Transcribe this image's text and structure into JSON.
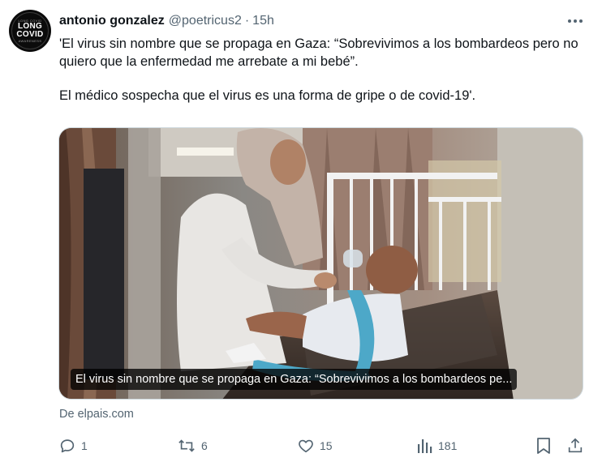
{
  "author": {
    "display_name": "antonio gonzalez",
    "handle": "@poetricus2",
    "separator": "·",
    "time": "15h",
    "avatar": {
      "line1": "LONG",
      "line2": "COVID",
      "top_text": "LONG COVID",
      "bottom_text": "AWARENESS"
    }
  },
  "post": {
    "paragraph1": "'El virus sin nombre que se propaga en Gaza: “Sobrevivimos a los bombardeos pero no quiero que la enfermedad me arrebate a mi bebé”.",
    "paragraph2": "El médico sospecha que el virus es una forma de gripe o de covid-19'."
  },
  "card": {
    "caption": "El virus sin nombre que se propaga en Gaza: “Sobrevivimos a los bombardeos pe...",
    "source": "De elpais.com"
  },
  "actions": {
    "replies": "1",
    "reposts": "6",
    "likes": "15",
    "views": "181"
  },
  "colors": {
    "text": "#0f1419",
    "secondary": "#536471",
    "border": "#cfd9de"
  }
}
